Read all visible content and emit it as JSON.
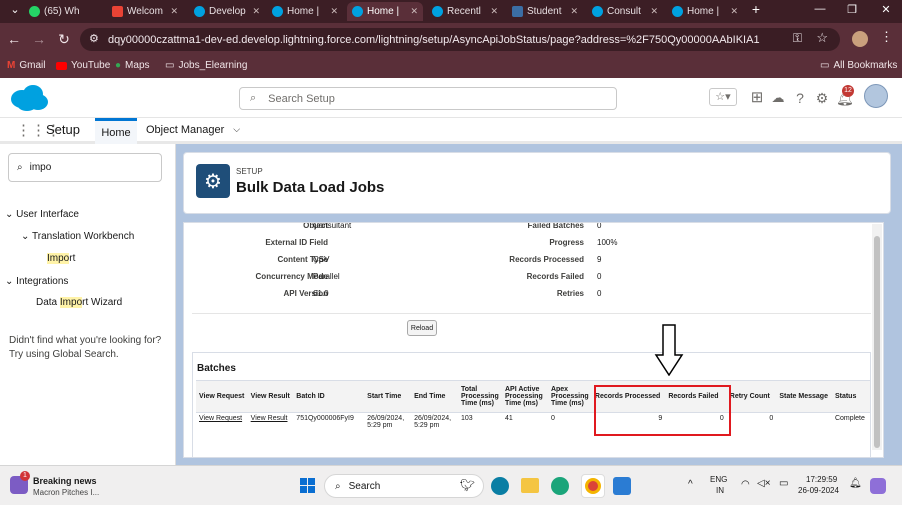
{
  "browser": {
    "tabs": [
      {
        "label": "(65) Wh",
        "color": "#25d366"
      },
      {
        "label": "Welcom",
        "color": "#ea4335"
      },
      {
        "label": "Develop",
        "color": "#00a1e0"
      },
      {
        "label": "Home |",
        "color": "#00a1e0"
      },
      {
        "label": "Home |",
        "color": "#00a1e0"
      },
      {
        "label": "Recentl",
        "color": "#00a1e0"
      },
      {
        "label": "Student",
        "color": "#3b6ea5"
      },
      {
        "label": "Consult",
        "color": "#00a1e0"
      },
      {
        "label": "Home |",
        "color": "#00a1e0"
      }
    ],
    "new_tab": "+",
    "url": "dqy00000czattma1-dev-ed.develop.lightning.force.com/lightning/setup/AsyncApiJobStatus/page?address=%2F750Qy00000AAbIKIA1",
    "bookmarks": [
      "Gmail",
      "YouTube",
      "Maps",
      "Jobs_Elearning"
    ],
    "all_bookmarks": "All Bookmarks"
  },
  "sf_header": {
    "search_placeholder": "Search Setup",
    "notif_count": "12"
  },
  "nav": {
    "app_name": "Setup",
    "tabs": [
      "Home",
      "Object Manager"
    ]
  },
  "sidebar": {
    "quick_find_value": "impo",
    "user_interface": "User Interface",
    "translation_workbench": "Translation Workbench",
    "import_pre": "",
    "import_hl": "Impo",
    "import_post": "rt",
    "integrations": "Integrations",
    "diw_pre": "Data ",
    "diw_hl": "Impo",
    "diw_post": "rt Wizard",
    "not_found_1": "Didn't find what you're looking for?",
    "not_found_2": "Try using Global Search."
  },
  "page": {
    "breadcrumb": "SETUP",
    "title": "Bulk Data Load Jobs"
  },
  "job": {
    "object_label": "Object",
    "object_value": "Consultant",
    "failed_batches_label": "Failed Batches",
    "failed_batches_value": "0",
    "ext_id_label": "External ID Field",
    "ext_id_value": "",
    "progress_label": "Progress",
    "progress_value": "100%",
    "content_type_label": "Content Type",
    "content_type_value": "CSV",
    "records_processed_label": "Records Processed",
    "records_processed_value": "9",
    "concurrency_label": "Concurrency Mode",
    "concurrency_value": "Parallel",
    "records_failed_label": "Records Failed",
    "records_failed_value": "0",
    "api_version_label": "API Version",
    "api_version_value": "61.0",
    "retries_label": "Retries",
    "retries_value": "0",
    "reload_label": "Reload"
  },
  "batches": {
    "title": "Batches",
    "headers": [
      "View Request",
      "View Result",
      "Batch ID",
      "Start Time",
      "End Time",
      "Total Processing Time (ms)",
      "API Active Processing Time (ms)",
      "Apex Processing Time (ms)",
      "Records Processed",
      "Records Failed",
      "Retry Count",
      "State Message",
      "Status"
    ],
    "row": {
      "view_request": "View Request",
      "view_result": "View Result",
      "batch_id": "751Qy000006FyI9",
      "start_time": "26/09/2024, 5:29 pm",
      "end_time": "26/09/2024, 5:29 pm",
      "total_time": "103",
      "api_time": "41",
      "apex_time": "0",
      "records_processed": "9",
      "records_failed": "0",
      "retry_count": "0",
      "state_message": "",
      "status": "Complete"
    }
  },
  "taskbar": {
    "news_title": "Breaking news",
    "news_sub": "Macron Pitches I...",
    "news_badge": "1",
    "search_label": "Search",
    "lang_1": "ENG",
    "lang_2": "IN",
    "time": "17:29:59",
    "date": "26-09-2024"
  }
}
